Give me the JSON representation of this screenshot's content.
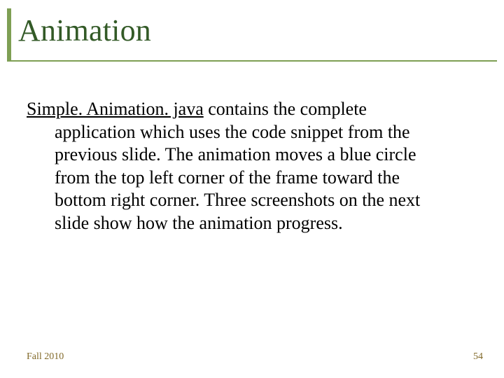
{
  "title": "Animation",
  "body": {
    "link_text": "Simple. Animation. java",
    "paragraph_rest": " contains the complete application which uses the code snippet from the previous slide.  The animation moves a blue circle from the top left corner of the frame toward the bottom right corner.  Three screenshots on the next slide show how the animation progress."
  },
  "footer": {
    "left": "Fall 2010",
    "right": "54"
  },
  "colors": {
    "title": "#335a27",
    "accent": "#7e9f54",
    "footer": "#826a2a"
  }
}
